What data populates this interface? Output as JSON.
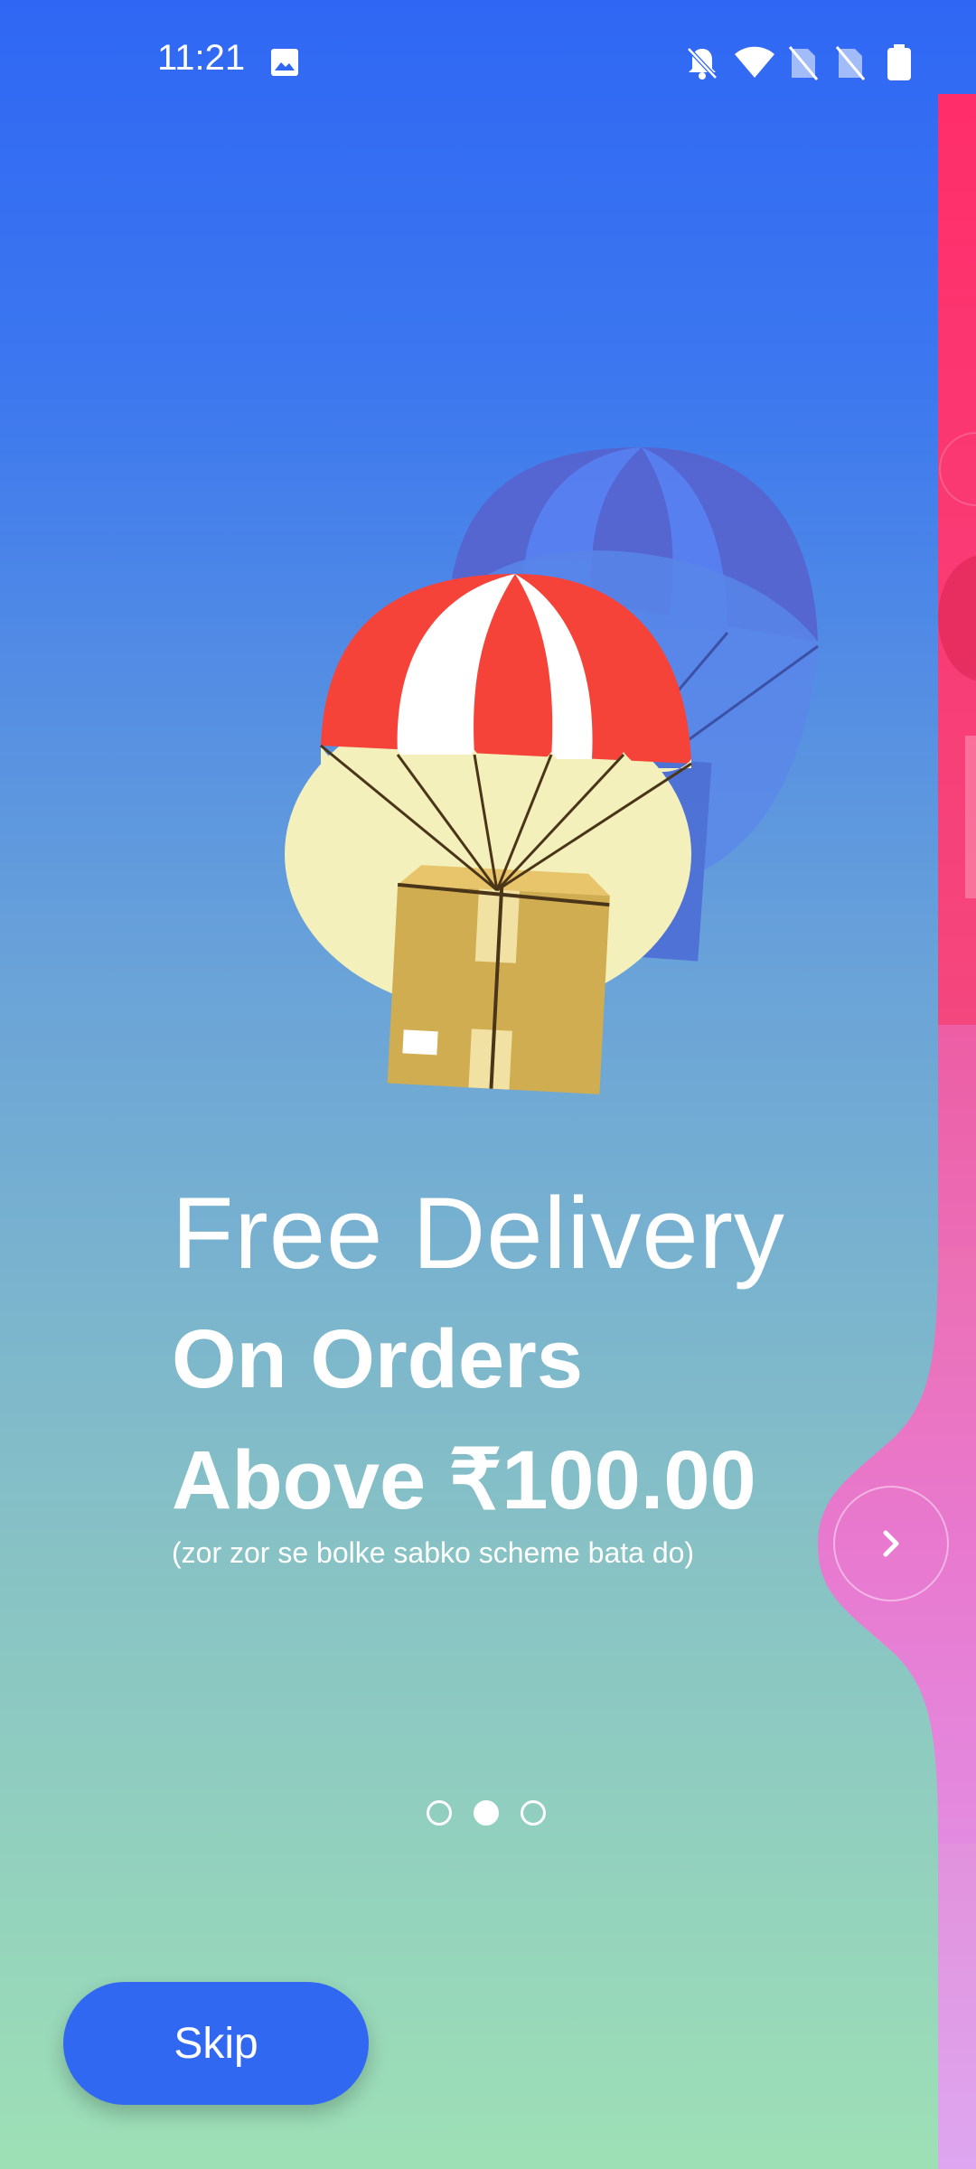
{
  "status_bar": {
    "time": "11:21",
    "icons": [
      "image-icon",
      "bell-off-icon",
      "wifi-icon",
      "no-sim-icon",
      "no-sim-icon",
      "battery-icon"
    ]
  },
  "onboarding": {
    "headline_light": "Free Delivery",
    "headline_bold_line1": "On Orders",
    "headline_bold_line2": "Above ₹100.00",
    "subtext": "(zor zor se bolke sabko scheme bata do)",
    "page_count": 3,
    "current_page_index": 1,
    "illustration": "parachute-box-illustration"
  },
  "actions": {
    "skip_label": "Skip",
    "next_icon": "chevron-right-icon"
  },
  "colors": {
    "primary_blue": "#3068f2",
    "parachute_red": "#f5433a",
    "next_page_pink": "#f04a8d"
  }
}
